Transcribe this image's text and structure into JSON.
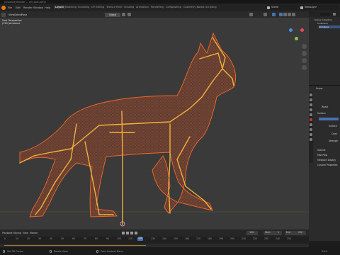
{
  "window": {
    "title": "[Unsaved] Blender — cat_walk.blend"
  },
  "menubar": {
    "menus": [
      "File",
      "Edit",
      "Render",
      "Window",
      "Help"
    ],
    "workspaces": [
      "Layout",
      "Modeling",
      "Sculpting",
      "UV Editing",
      "Texture Paint",
      "Shading",
      "Animation",
      "Rendering",
      "Compositing",
      "Geometry Nodes",
      "Scripting"
    ],
    "active_workspace": "Layout",
    "scene": "Scene",
    "view_layer": "ViewLayer"
  },
  "viewport": {
    "mode": "Pose Mode",
    "menus": [
      "View",
      "Select",
      "Pose"
    ],
    "transform_orientation": "Global",
    "overlay": [
      "User Perspective",
      "(120) Armature"
    ]
  },
  "outliner": {
    "items": [
      "Scene Collection",
      "Collection",
      "Armature"
    ],
    "selected": "Armature"
  },
  "properties": {
    "scene_label": "Scene",
    "world_label": "World",
    "surface_section": "Surface",
    "rows": [
      "Surface",
      "Color",
      "Strength"
    ],
    "sections": [
      "Volume",
      "Mist Pass",
      "Viewport Display",
      "Custom Properties"
    ]
  },
  "timeline": {
    "menus": [
      "Playback",
      "Keying",
      "View",
      "Marker"
    ],
    "current_frame": "120",
    "start_label": "Start",
    "start": "1",
    "end_label": "End",
    "end": "250",
    "frames": [
      "0",
      "10",
      "20",
      "30",
      "40",
      "50",
      "60",
      "70",
      "80",
      "90",
      "100",
      "110",
      "120",
      "130",
      "140",
      "150",
      "160",
      "170",
      "180",
      "190",
      "200",
      "210",
      "220",
      "230",
      "240",
      "250"
    ]
  },
  "statusbar": {
    "left": "Set 3D Cursor",
    "middle": "Rotate View",
    "right": "Pose Context Menu",
    "version": "3.6.0"
  },
  "colors": {
    "mesh": "#e8521e",
    "bone": "#f2b13c",
    "accent": "#4772b3"
  }
}
